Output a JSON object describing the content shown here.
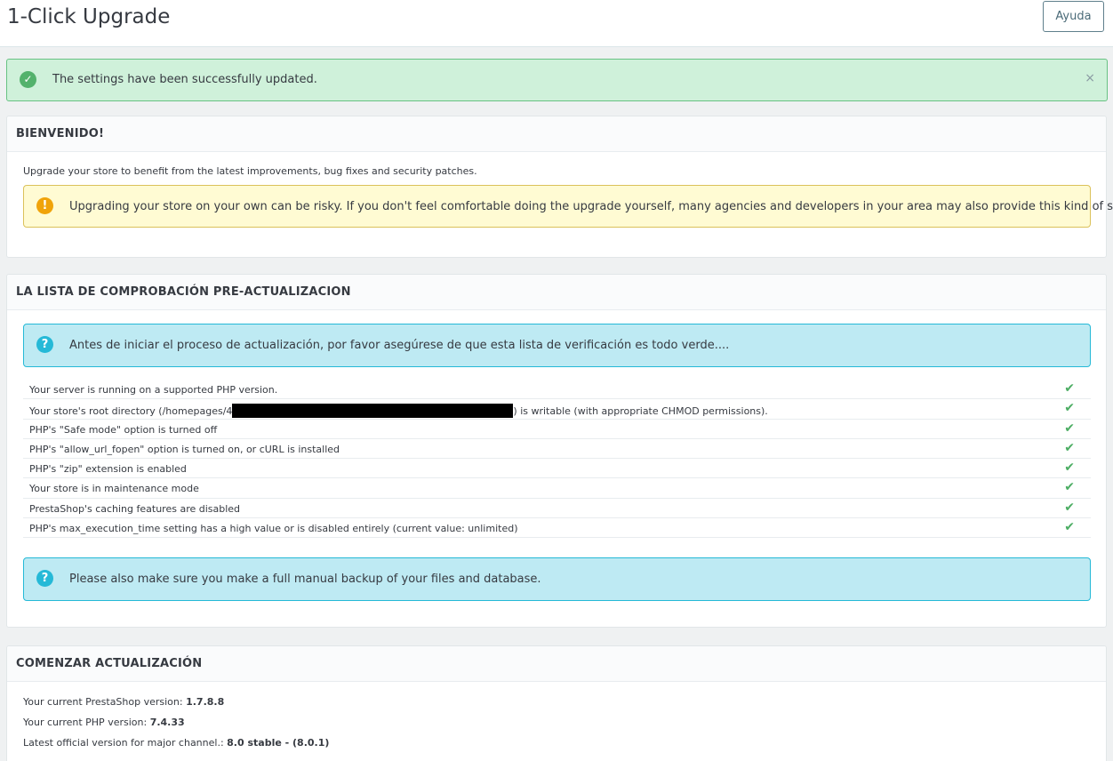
{
  "header": {
    "title": "1-Click Upgrade",
    "help_label": "Ayuda"
  },
  "alert": {
    "message": "The settings have been successfully updated.",
    "close": "×"
  },
  "welcome": {
    "title": "BIENVENIDO!",
    "intro": "Upgrade your store to benefit from the latest improvements, bug fixes and security patches.",
    "warning": "Upgrading your store on your own can be risky. If you don't feel comfortable doing the upgrade yourself, many agencies and developers in your area may also provide this kind of service."
  },
  "checklist": {
    "title": "LA LISTA DE COMPROBACIÓN PRE-ACTUALIZACION",
    "info": "Antes de iniciar el proceso de actualización, por favor asegúrese de que esta lista de verificación es todo verde....",
    "items": [
      {
        "label": "Your server is running on a supported PHP version."
      },
      {
        "label_before": "Your store's root directory (/homepages/4",
        "label_after": ") is writable (with appropriate CHMOD permissions)."
      },
      {
        "label": "PHP's \"Safe mode\" option is turned off"
      },
      {
        "label": "PHP's \"allow_url_fopen\" option is turned on, or cURL is installed"
      },
      {
        "label": "PHP's \"zip\" extension is enabled"
      },
      {
        "label": "Your store is in maintenance mode"
      },
      {
        "label": "PrestaShop's caching features are disabled"
      },
      {
        "label": "PHP's max_execution_time setting has a high value or is disabled entirely (current value: unlimited)"
      }
    ],
    "check_icon": "✔",
    "backup_info": "Please also make sure you make a full manual backup of your files and database."
  },
  "upgrade": {
    "title": "COMENZAR ACTUALIZACIÓN",
    "ps_version_label": "Your current PrestaShop version: ",
    "ps_version": "1.7.8.8",
    "php_version_label": "Your current PHP version: ",
    "php_version": "7.4.33",
    "latest_label": "Latest official version for major channel.: ",
    "latest_value": "8.0 stable - (8.0.1)"
  },
  "colors": {
    "success": "#53b26c",
    "warning": "#f0a30a",
    "info": "#25b9d7",
    "check": "#4cad63"
  }
}
